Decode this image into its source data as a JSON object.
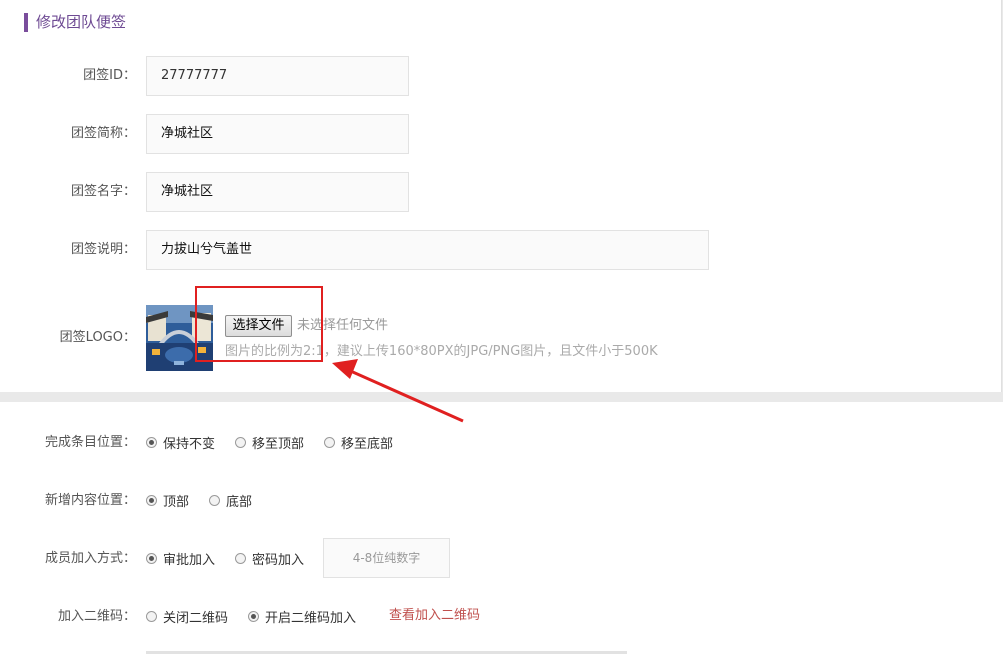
{
  "page_title": "修改团队便签",
  "fields": {
    "id": {
      "label": "团签ID：",
      "value": "27777777"
    },
    "short_name": {
      "label": "团签简称：",
      "value": "净城社区"
    },
    "name": {
      "label": "团签名字：",
      "value": "净城社区"
    },
    "description": {
      "label": "团签说明：",
      "value": "力拔山兮气盖世"
    },
    "logo": {
      "label": "团签LOGO：",
      "choose_file_label": "选择文件",
      "file_status": "未选择任何文件",
      "hint": "图片的比例为2:1，建议上传160*80PX的JPG/PNG图片，且文件小于500K"
    }
  },
  "options": {
    "complete_position": {
      "label": "完成条目位置：",
      "choices": [
        "保持不变",
        "移至顶部",
        "移至底部"
      ],
      "selected": 0
    },
    "new_content_position": {
      "label": "新增内容位置：",
      "choices": [
        "顶部",
        "底部"
      ],
      "selected": 0
    },
    "join_method": {
      "label": "成员加入方式：",
      "choices": [
        "审批加入",
        "密码加入"
      ],
      "selected": 0,
      "password_placeholder": "4-8位纯数字"
    },
    "join_qr": {
      "label": "加入二维码：",
      "choices": [
        "关闭二维码",
        "开启二维码加入"
      ],
      "selected": 1,
      "link": "查看加入二维码"
    }
  },
  "colors": {
    "accent": "#6e4a93",
    "annotation": "#e02020",
    "link": "#c0504d"
  },
  "annotations": {
    "highlight_box": "red-rectangle",
    "arrow": "red-arrow"
  }
}
